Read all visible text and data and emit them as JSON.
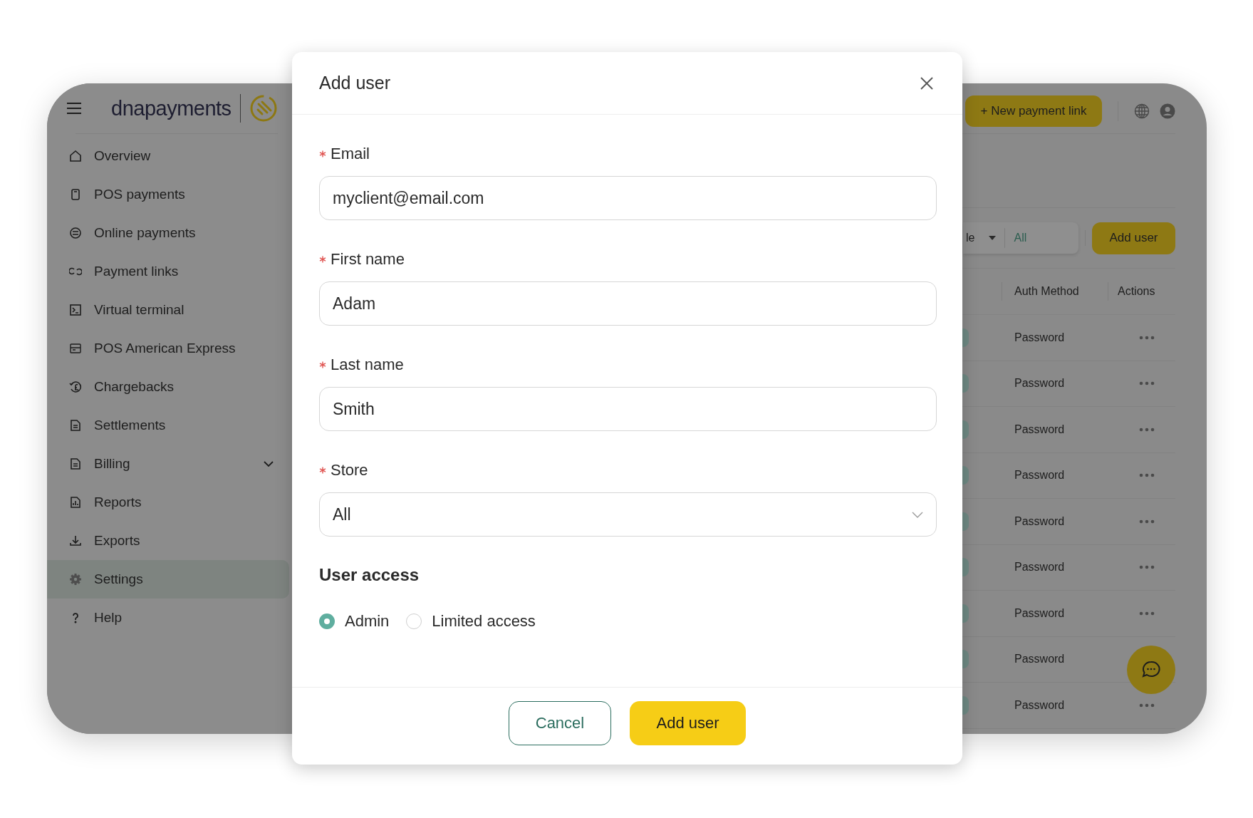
{
  "sidebar": {
    "brand": "**dna**payments",
    "items": [
      {
        "label": "Overview",
        "kind": "link",
        "selected": false
      },
      {
        "label": "POS payments",
        "kind": "link",
        "selected": false
      },
      {
        "label": "Online payments",
        "kind": "link",
        "selected": false
      },
      {
        "label": "Payment links",
        "kind": "link",
        "selected": false
      },
      {
        "label": "Virtual terminal",
        "kind": "link",
        "selected": false
      },
      {
        "label": "POS American Express",
        "kind": "link",
        "selected": false
      },
      {
        "label": "Chargebacks",
        "kind": "link",
        "selected": false
      },
      {
        "label": "Settlements",
        "kind": "link",
        "selected": false
      },
      {
        "label": "Billing",
        "kind": "group",
        "selected": false
      },
      {
        "label": "Reports",
        "kind": "link",
        "selected": false
      },
      {
        "label": "Exports",
        "kind": "link",
        "selected": false
      },
      {
        "label": "Settings",
        "kind": "link",
        "selected": true
      },
      {
        "label": "Help",
        "kind": "link",
        "selected": false
      }
    ]
  },
  "topbar": {
    "new_link_button": "+ New payment link"
  },
  "filters": {
    "filter_label": "le",
    "filter_value": "All",
    "add_user_button": "Add user"
  },
  "table": {
    "columns": [
      "Auth Method",
      "Actions"
    ],
    "rows": [
      {
        "auth_method": "Password"
      },
      {
        "auth_method": "Password"
      },
      {
        "auth_method": "Password"
      },
      {
        "auth_method": "Password"
      },
      {
        "auth_method": "Password"
      },
      {
        "auth_method": "Password"
      },
      {
        "auth_method": "Password"
      },
      {
        "auth_method": "Password"
      },
      {
        "auth_method": "Password"
      }
    ]
  },
  "modal": {
    "title": "Add user",
    "fields": [
      {
        "label": "Email",
        "required": true,
        "kind": "text",
        "value": "myclient@email.com"
      },
      {
        "label": "First name",
        "required": true,
        "kind": "text",
        "value": "Adam"
      },
      {
        "label": "Last name",
        "required": true,
        "kind": "text",
        "value": "Smith"
      },
      {
        "label": "Store",
        "required": true,
        "kind": "select",
        "value": "All"
      }
    ],
    "access": {
      "title": "User access",
      "options": [
        {
          "label": "Admin",
          "selected": true
        },
        {
          "label": "Limited access",
          "selected": false
        }
      ]
    },
    "buttons": {
      "cancel": "Cancel",
      "submit": "Add user"
    }
  }
}
